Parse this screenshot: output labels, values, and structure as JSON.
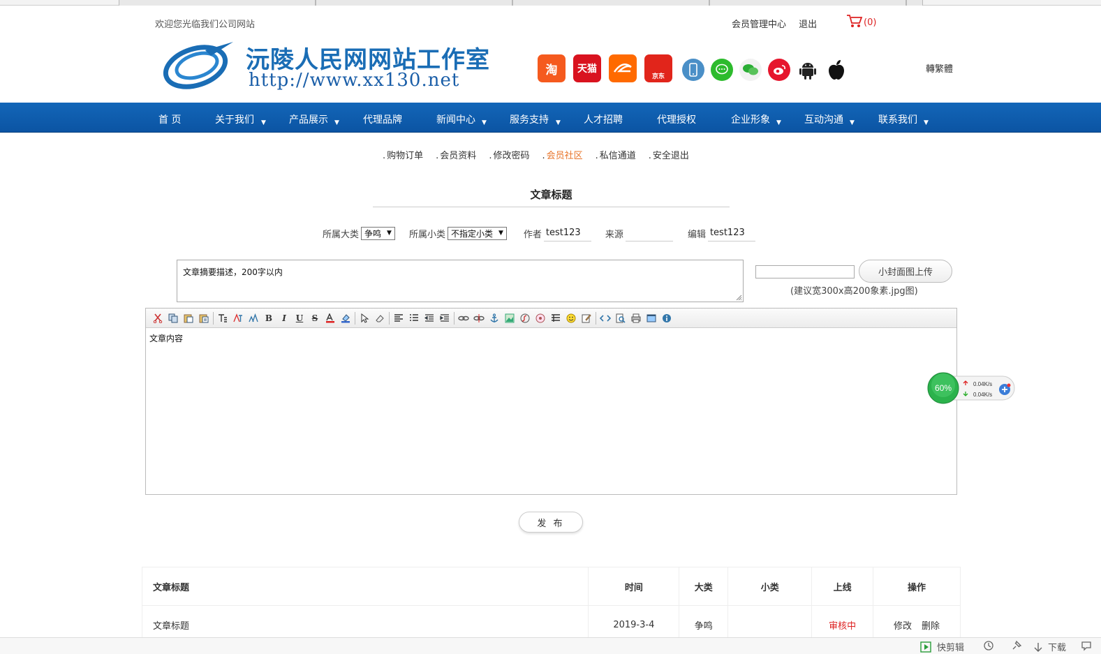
{
  "header": {
    "welcome": "欢迎您光临我们公司网站",
    "member_center": "会员管理中心",
    "logout": "退出",
    "cart_count": "(0)",
    "logo_title": "沅陵人民网网站工作室",
    "logo_url": "http://www.xx130.net",
    "traditional": "轉繁體",
    "shop_icons": [
      {
        "name": "taobao",
        "label": "淘",
        "color": "#f55a1e"
      },
      {
        "name": "tmall",
        "label": "天猫",
        "color": "#d9131f"
      },
      {
        "name": "alibaba",
        "label": "",
        "color": "#ff6a00"
      },
      {
        "name": "jd",
        "label": "京东",
        "color": "#e1251b"
      }
    ],
    "social_icons": [
      {
        "name": "phone-icon",
        "color": "#4a8fc7"
      },
      {
        "name": "message-icon",
        "color": "#2dbb2d"
      },
      {
        "name": "wechat-icon",
        "color": "#2aad34"
      },
      {
        "name": "weibo-icon",
        "color": "#e6162d"
      },
      {
        "name": "android-icon",
        "color": "#222222"
      },
      {
        "name": "apple-icon",
        "color": "#111111"
      }
    ]
  },
  "nav": {
    "items": [
      {
        "label": "首 页",
        "dropdown": false
      },
      {
        "label": "关于我们",
        "dropdown": true
      },
      {
        "label": "产品展示",
        "dropdown": true
      },
      {
        "label": "代理品牌",
        "dropdown": false
      },
      {
        "label": "新闻中心",
        "dropdown": true
      },
      {
        "label": "服务支持",
        "dropdown": true
      },
      {
        "label": "人才招聘",
        "dropdown": false
      },
      {
        "label": "代理授权",
        "dropdown": false
      },
      {
        "label": "企业形象",
        "dropdown": true
      },
      {
        "label": "互动沟通",
        "dropdown": true
      },
      {
        "label": "联系我们",
        "dropdown": true
      }
    ],
    "bg_color": "#0f5eae"
  },
  "submenu": {
    "items": [
      "购物订单",
      "会员资料",
      "修改密码",
      "会员社区",
      "私信通道",
      "安全退出"
    ],
    "active": "会员社区",
    "active_color": "#e8742a"
  },
  "form": {
    "title": "文章标题",
    "category_label": "所属大类",
    "category_value": "争鸣",
    "subcategory_label": "所属小类",
    "subcategory_value": "不指定小类",
    "author_label": "作者",
    "author_value": "test123",
    "source_label": "来源",
    "source_value": "",
    "editor_label": "编辑",
    "editor_value": "test123",
    "summary_placeholder": "文章摘要描述，200字以内",
    "upload_button": "小封面图上传",
    "upload_hint": "(建议宽300x高200象素.jpg图)",
    "content_placeholder": "文章内容",
    "publish_button": "发 布"
  },
  "network_widget": {
    "percent": "60%",
    "upload_speed": "0.04K/s",
    "download_speed": "0.04K/s"
  },
  "table": {
    "headers": [
      "文章标题",
      "时间",
      "大类",
      "小类",
      "上线",
      "操作"
    ],
    "rows": [
      {
        "title": "文章标题",
        "time": "2019-3-4",
        "category": "争鸣",
        "subcategory": "",
        "status": "审核中",
        "edit": "修改",
        "delete": "删除"
      }
    ]
  },
  "statusbar": {
    "quick_edit": "快剪辑",
    "download": "下载"
  }
}
